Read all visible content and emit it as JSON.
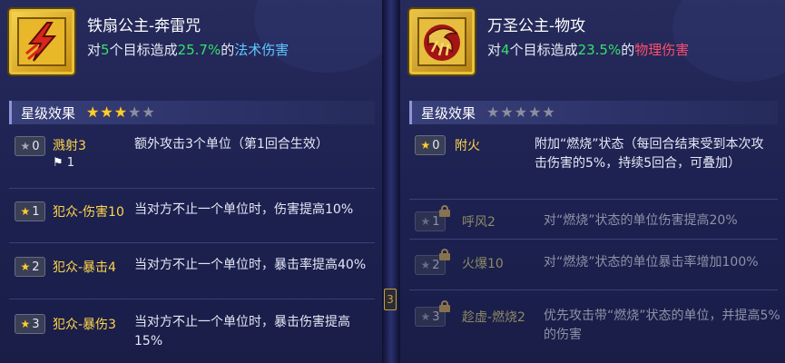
{
  "left": {
    "skill": {
      "name": "铁扇公主-奔雷咒",
      "desc_prefix": "对",
      "target_count": "5",
      "desc_mid": "个目标造成",
      "percent": "25.7%",
      "desc_of": "的",
      "damage_type": "法术伤害",
      "icon": "lightning-bolt-icon"
    },
    "star_section": {
      "title": "星级效果",
      "stars_filled": 3,
      "stars_total": 5
    },
    "effects": [
      {
        "level": "0",
        "name": "溅射3",
        "desc": "额外攻击3个单位（第1回合生效）",
        "flag_count": "1",
        "star_color": "grey"
      },
      {
        "level": "1",
        "name": "犯众-伤害10",
        "desc": "当对方不止一个单位时，伤害提高10%",
        "star_color": "gold"
      },
      {
        "level": "2",
        "name": "犯众-暴击4",
        "desc": "当对方不止一个单位时，暴击率提高40%",
        "star_color": "gold"
      },
      {
        "level": "3",
        "name": "犯众-暴伤3",
        "desc": "当对方不止一个单位时，暴击伤害提高15%",
        "star_color": "gold"
      }
    ]
  },
  "right": {
    "skill": {
      "name": "万圣公主-物攻",
      "desc_prefix": "对",
      "target_count": "4",
      "desc_mid": "个目标造成",
      "percent": "23.5%",
      "desc_of": "的",
      "damage_type": "物理伤害",
      "icon": "fire-claw-icon"
    },
    "star_section": {
      "title": "星级效果",
      "stars_filled": 0,
      "stars_total": 5
    },
    "effects": [
      {
        "level": "0",
        "name": "附火",
        "desc": "附加“燃烧”状态（每回合结束受到本次攻击伤害的5%，持续5回合，可叠加）",
        "locked": false
      },
      {
        "level": "1",
        "name": "呼风2",
        "desc": "对“燃烧”状态的单位伤害提高20%",
        "locked": true
      },
      {
        "level": "2",
        "name": "火爆10",
        "desc": "对“燃烧”状态的单位暴击率增加100%",
        "locked": true
      },
      {
        "level": "3",
        "name": "趁虚-燃烧2",
        "desc": "优先攻击带“燃烧”状态的单位，并提高5%的伤害",
        "locked": true
      }
    ]
  },
  "divider": {
    "glyph": "3"
  }
}
